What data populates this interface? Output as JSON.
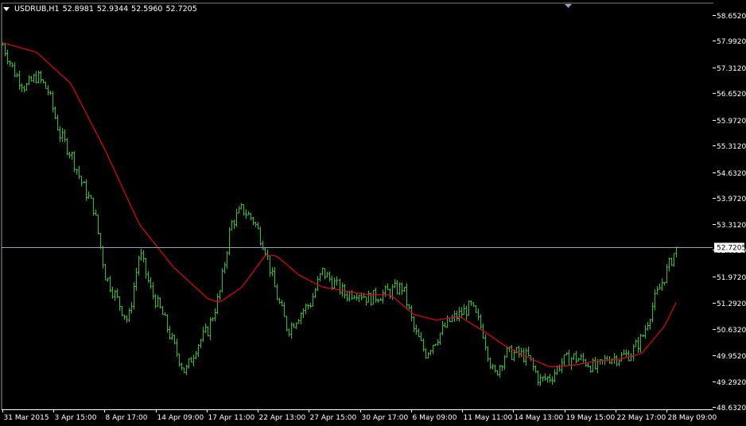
{
  "chart": {
    "symbol": "USDRUB,H1",
    "ohlc": [
      "52.8981",
      "52.9344",
      "52.5960",
      "52.7205"
    ],
    "current_price_label": "52.7205"
  },
  "colors": {
    "background": "#000000",
    "bars": "#22c22a",
    "moving_average": "#e8000b",
    "axis": "#ffffff",
    "price_line": "#8fa3b8",
    "price_tag_bg": "#ffffff",
    "price_tag_text": "#000000"
  },
  "chart_data": {
    "type": "bar",
    "instrument": "USDRUB",
    "timeframe": "H1",
    "y_ticks": [
      "58.6520",
      "57.9920",
      "57.3120",
      "56.6520",
      "55.9720",
      "55.3120",
      "54.6320",
      "53.9720",
      "53.3120",
      "52.6520",
      "51.9720",
      "51.2920",
      "50.6320",
      "49.9520",
      "49.2920",
      "48.6320"
    ],
    "ylim": [
      48.632,
      58.652
    ],
    "x_ticks": [
      "31 Mar 2015",
      "3 Apr 15:00",
      "8 Apr 17:00",
      "14 Apr 09:00",
      "17 Apr 11:00",
      "22 Apr 13:00",
      "27 Apr 15:00",
      "30 Apr 17:00",
      "6 May 09:00",
      "11 May 11:00",
      "14 May 13:00",
      "19 May 15:00",
      "22 May 17:00",
      "28 May 09:00"
    ],
    "last_close": 52.7205,
    "price_path": [
      [
        0,
        57.9
      ],
      [
        1,
        57.2
      ],
      [
        2,
        56.8
      ],
      [
        3,
        57.1
      ],
      [
        4,
        56.7
      ],
      [
        5,
        55.6
      ],
      [
        6,
        55.1
      ],
      [
        7,
        54.3
      ],
      [
        8,
        53.7
      ],
      [
        9,
        52.0
      ],
      [
        10,
        51.4
      ],
      [
        11,
        50.8
      ],
      [
        12,
        52.6
      ],
      [
        13,
        51.6
      ],
      [
        14,
        51.0
      ],
      [
        15,
        50.2
      ],
      [
        16,
        49.5
      ],
      [
        17,
        50.2
      ],
      [
        18,
        50.6
      ],
      [
        19,
        51.5
      ],
      [
        20,
        53.3
      ],
      [
        21,
        53.7
      ],
      [
        22,
        53.4
      ],
      [
        23,
        52.7
      ],
      [
        24,
        51.5
      ],
      [
        25,
        50.6
      ],
      [
        26,
        51.0
      ],
      [
        27,
        51.3
      ],
      [
        28,
        52.1
      ],
      [
        29,
        51.8
      ],
      [
        30,
        51.5
      ],
      [
        31,
        51.6
      ],
      [
        32,
        51.4
      ],
      [
        33,
        51.5
      ],
      [
        34,
        51.6
      ],
      [
        35,
        51.7
      ],
      [
        36,
        50.6
      ],
      [
        37,
        50.0
      ],
      [
        38,
        50.4
      ],
      [
        39,
        50.8
      ],
      [
        40,
        51.0
      ],
      [
        41,
        51.2
      ],
      [
        42,
        50.6
      ],
      [
        43,
        49.4
      ],
      [
        44,
        50.0
      ],
      [
        45,
        50.0
      ],
      [
        46,
        49.9
      ],
      [
        47,
        49.3
      ],
      [
        48,
        49.4
      ],
      [
        49,
        49.8
      ],
      [
        50,
        49.9
      ],
      [
        51,
        49.8
      ],
      [
        52,
        49.6
      ],
      [
        53,
        49.9
      ],
      [
        54,
        49.9
      ],
      [
        55,
        50.0
      ],
      [
        56,
        50.4
      ],
      [
        57,
        51.3
      ],
      [
        58,
        52.0
      ],
      [
        59,
        52.7
      ]
    ],
    "moving_average": [
      [
        0,
        57.95
      ],
      [
        3,
        57.7
      ],
      [
        6,
        56.9
      ],
      [
        9,
        55.2
      ],
      [
        12,
        53.3
      ],
      [
        15,
        52.2
      ],
      [
        18,
        51.4
      ],
      [
        19,
        51.3
      ],
      [
        21,
        51.7
      ],
      [
        23,
        52.5
      ],
      [
        24,
        52.5
      ],
      [
        26,
        52.0
      ],
      [
        28,
        51.7
      ],
      [
        30,
        51.6
      ],
      [
        32,
        51.5
      ],
      [
        34,
        51.5
      ],
      [
        36,
        51.0
      ],
      [
        38,
        50.85
      ],
      [
        40,
        50.95
      ],
      [
        42,
        50.6
      ],
      [
        44,
        50.2
      ],
      [
        46,
        49.9
      ],
      [
        48,
        49.65
      ],
      [
        50,
        49.7
      ],
      [
        52,
        49.8
      ],
      [
        54,
        49.85
      ],
      [
        56,
        50.0
      ],
      [
        58,
        50.7
      ],
      [
        59,
        51.3
      ]
    ],
    "grid": false,
    "legend": "none"
  }
}
